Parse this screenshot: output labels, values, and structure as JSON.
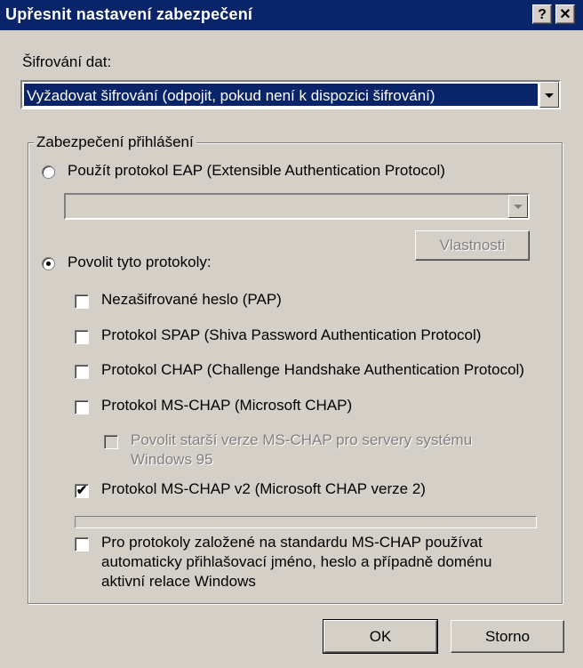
{
  "window": {
    "title": "Upřesnit nastavení zabezpečení",
    "help_glyph": "?",
    "close_glyph": "✕"
  },
  "encryption": {
    "label": "Šifrování dat:",
    "selected": "Vyžadovat šifrování (odpojit, pokud není k dispozici šifrování)"
  },
  "logon_security": {
    "legend": "Zabezpečení přihlášení",
    "eap_radio": {
      "label": "Použít protokol EAP (Extensible Authentication Protocol)",
      "checked": false
    },
    "eap_combo_value": "",
    "properties_button": "Vlastnosti",
    "allow_radio": {
      "label": "Povolit tyto protokoly:",
      "checked": true
    },
    "protocols": [
      {
        "label": "Nezašifrované heslo (PAP)",
        "checked": false
      },
      {
        "label": "Protokol SPAP (Shiva Password Authentication Protocol)",
        "checked": false
      },
      {
        "label": "Protokol CHAP (Challenge Handshake Authentication Protocol)",
        "checked": false
      },
      {
        "label": "Protokol MS-CHAP (Microsoft CHAP)",
        "checked": false
      }
    ],
    "win95_option": {
      "line1": "Povolit starší verze MS-CHAP pro servery systému",
      "line2": "Windows 95",
      "checked": false,
      "disabled": true
    },
    "mschapv2": {
      "label": "Protokol MS-CHAP v2 (Microsoft CHAP verze 2)",
      "checked": true
    },
    "auto_logon": {
      "line1": "Pro protokoly založené na standardu MS-CHAP používat",
      "line2": "automaticky přihlašovací jméno, heslo a případně doménu",
      "line3": "aktivní relace Windows",
      "checked": false
    }
  },
  "buttons": {
    "ok": "OK",
    "cancel": "Storno"
  },
  "colors": {
    "titlebar": "#0a246a",
    "face": "#d4d0c8",
    "selection": "#0a246a"
  }
}
